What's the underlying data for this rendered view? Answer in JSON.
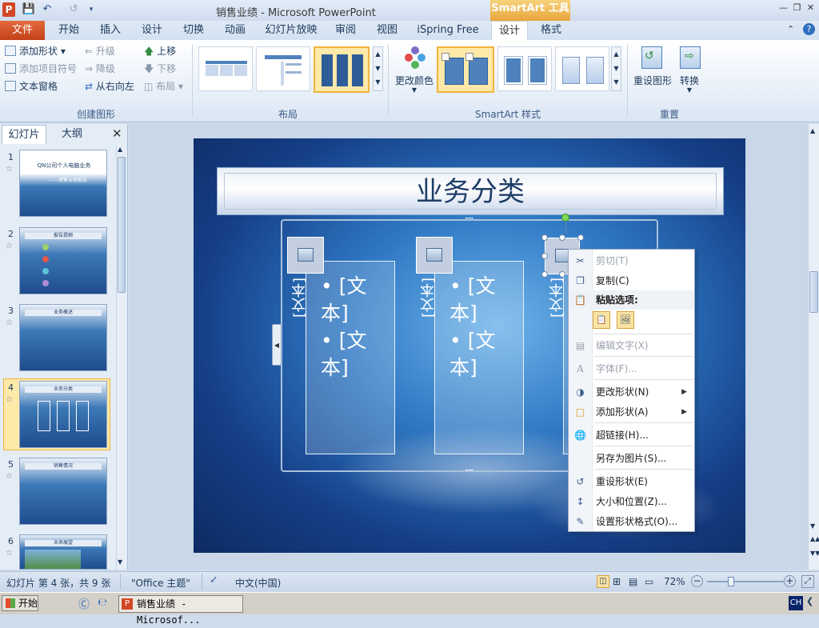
{
  "window": {
    "title": "销售业绩 - Microsoft PowerPoint",
    "app_icon": "P",
    "context_tab_group": "SmartArt 工具"
  },
  "tabs": [
    {
      "label": "文件"
    },
    {
      "label": "开始"
    },
    {
      "label": "插入"
    },
    {
      "label": "设计"
    },
    {
      "label": "切换"
    },
    {
      "label": "动画"
    },
    {
      "label": "幻灯片放映"
    },
    {
      "label": "审阅"
    },
    {
      "label": "视图"
    },
    {
      "label": "iSpring Free"
    },
    {
      "label": "设计"
    },
    {
      "label": "格式"
    }
  ],
  "ribbon": {
    "create_graphic": {
      "title": "创建图形",
      "add_shape": "添加形状",
      "add_bullet": "添加项目符号",
      "text_pane": "文本窗格",
      "promote": "升级",
      "demote": "降级",
      "right_to_left": "从右向左",
      "move_up": "上移",
      "move_down": "下移",
      "layout": "布局"
    },
    "layouts": {
      "title": "布局"
    },
    "styles": {
      "title": "SmartArt 样式",
      "change_colors": "更改颜色"
    },
    "reset": {
      "title": "重置",
      "reset_graphic": "重设图形",
      "convert": "转换"
    }
  },
  "left_pane": {
    "tabs": [
      "幻灯片",
      "大纲"
    ],
    "slides": [
      {
        "num": "1",
        "title": "QN公司个人电脑业务",
        "sub": "——销售业绩报告"
      },
      {
        "num": "2",
        "title": "报告提纲"
      },
      {
        "num": "3",
        "title": "业务概述"
      },
      {
        "num": "4",
        "title": "业务分类"
      },
      {
        "num": "5",
        "title": "销售情况"
      },
      {
        "num": "6",
        "title": "未来展望"
      }
    ]
  },
  "slide": {
    "title": "业务分类",
    "columns": [
      {
        "vertical": "[文本]",
        "bullets": [
          "[文本]",
          "[文本]"
        ]
      },
      {
        "vertical": "[文本]",
        "bullets": [
          "[文本]",
          "[文本]"
        ]
      },
      {
        "vertical": "[文本]",
        "bullets": []
      }
    ]
  },
  "context_menu": {
    "items": [
      {
        "label": "剪切(T)",
        "disabled": true,
        "icon": "scissors-icon"
      },
      {
        "label": "复制(C)",
        "disabled": false,
        "icon": "copy-icon"
      },
      {
        "label": "粘贴选项:",
        "disabled": false,
        "icon": "paste-icon"
      },
      {
        "label": "编辑文字(X)",
        "disabled": true,
        "icon": "edit-text-icon"
      },
      {
        "label": "字体(F)...",
        "disabled": true,
        "icon": "font-icon"
      },
      {
        "label": "更改形状(N)",
        "disabled": false,
        "icon": "change-shape-icon"
      },
      {
        "label": "添加形状(A)",
        "disabled": false,
        "icon": "add-shape-icon"
      },
      {
        "label": "超链接(H)...",
        "disabled": false,
        "icon": "hyperlink-icon"
      },
      {
        "label": "另存为图片(S)...",
        "disabled": false,
        "icon": "save-picture-icon"
      },
      {
        "label": "重设形状(E)",
        "disabled": false,
        "icon": "reset-shape-icon"
      },
      {
        "label": "大小和位置(Z)...",
        "disabled": false,
        "icon": "size-position-icon"
      },
      {
        "label": "设置形状格式(O)...",
        "disabled": false,
        "icon": "format-shape-icon"
      }
    ]
  },
  "status": {
    "slide_info": "幻灯片 第 4 张，共 9 张",
    "theme": "\"Office 主题\"",
    "language": "中文(中国)",
    "zoom": "72%"
  },
  "taskbar": {
    "start": "开始",
    "task": "销售业绩 - Microsof...",
    "tray": "CH"
  }
}
